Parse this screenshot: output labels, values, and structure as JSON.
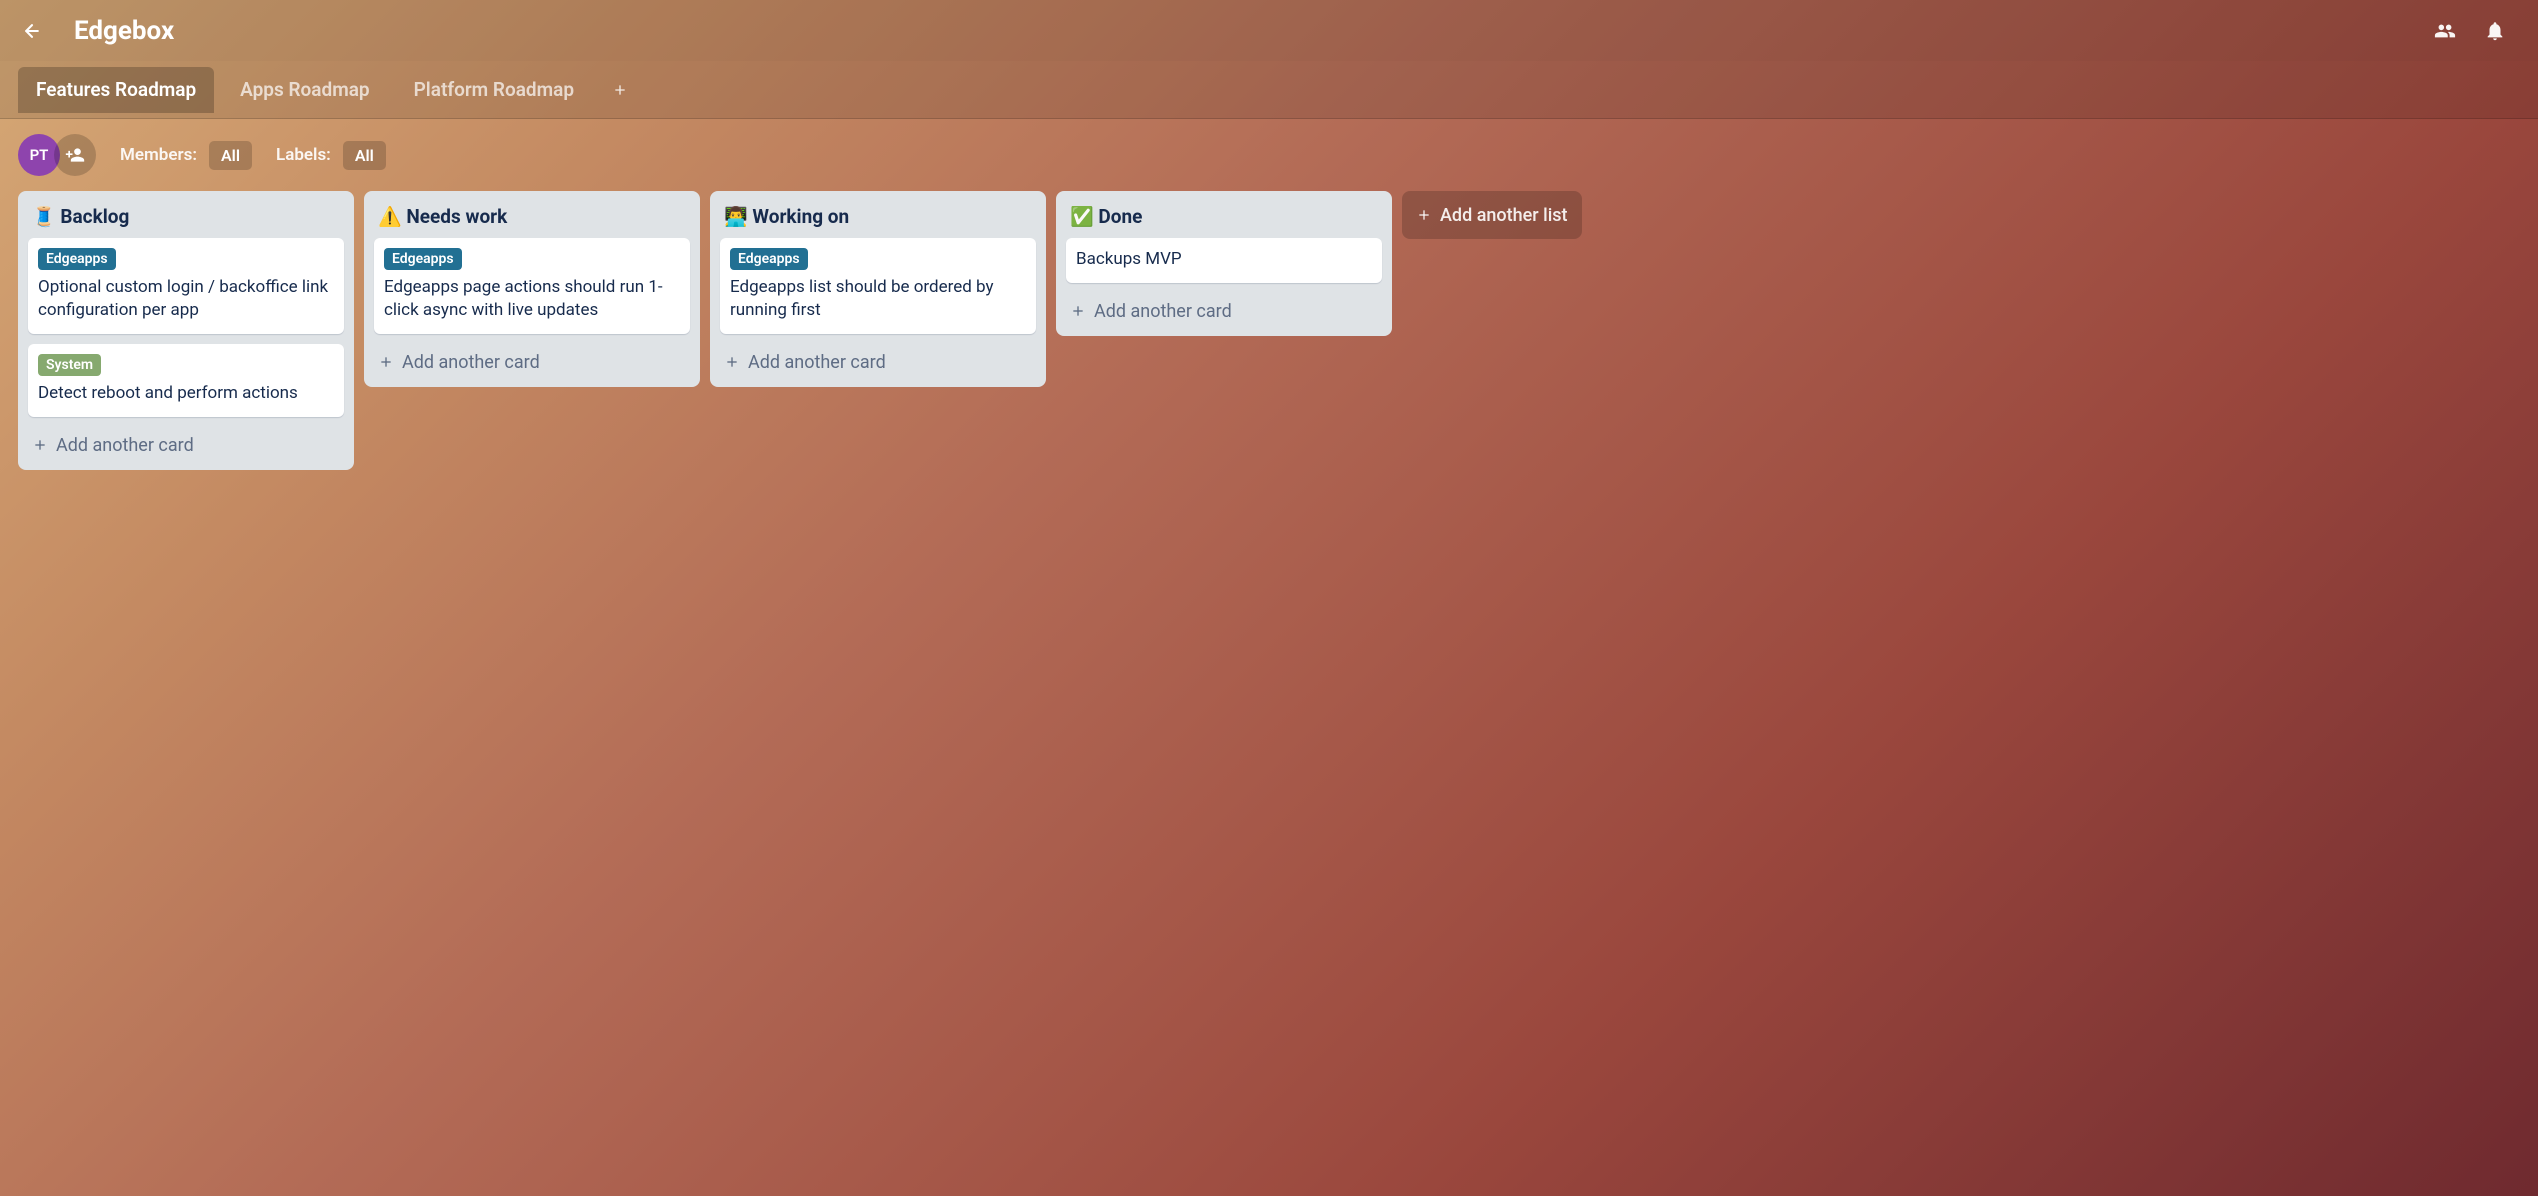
{
  "header": {
    "title": "Edgebox"
  },
  "tabs": [
    {
      "label": "Features Roadmap",
      "active": true
    },
    {
      "label": "Apps Roadmap",
      "active": false
    },
    {
      "label": "Platform Roadmap",
      "active": false
    }
  ],
  "filters": {
    "avatar_initials": "PT",
    "members_label": "Members:",
    "members_value": "All",
    "labels_label": "Labels:",
    "labels_value": "All"
  },
  "lists": [
    {
      "title": "🧵 Backlog",
      "cards": [
        {
          "labels": [
            {
              "text": "Edgeapps",
              "color": "blue"
            }
          ],
          "text": "Optional custom login / backoffice link configuration per app"
        },
        {
          "labels": [
            {
              "text": "System",
              "color": "green"
            }
          ],
          "text": "Detect reboot and perform actions"
        }
      ]
    },
    {
      "title": "⚠️ Needs work",
      "cards": [
        {
          "labels": [
            {
              "text": "Edgeapps",
              "color": "blue"
            }
          ],
          "text": "Edgeapps page actions should run 1-click async with live updates"
        }
      ]
    },
    {
      "title": "👨‍💻 Working on",
      "cards": [
        {
          "labels": [
            {
              "text": "Edgeapps",
              "color": "blue"
            }
          ],
          "text": "Edgeapps list should be ordered by running first"
        }
      ]
    },
    {
      "title": "✅ Done",
      "cards": [
        {
          "labels": [],
          "text": "Backups MVP"
        }
      ]
    }
  ],
  "actions": {
    "add_card": "Add another card",
    "add_list": "Add another list"
  }
}
